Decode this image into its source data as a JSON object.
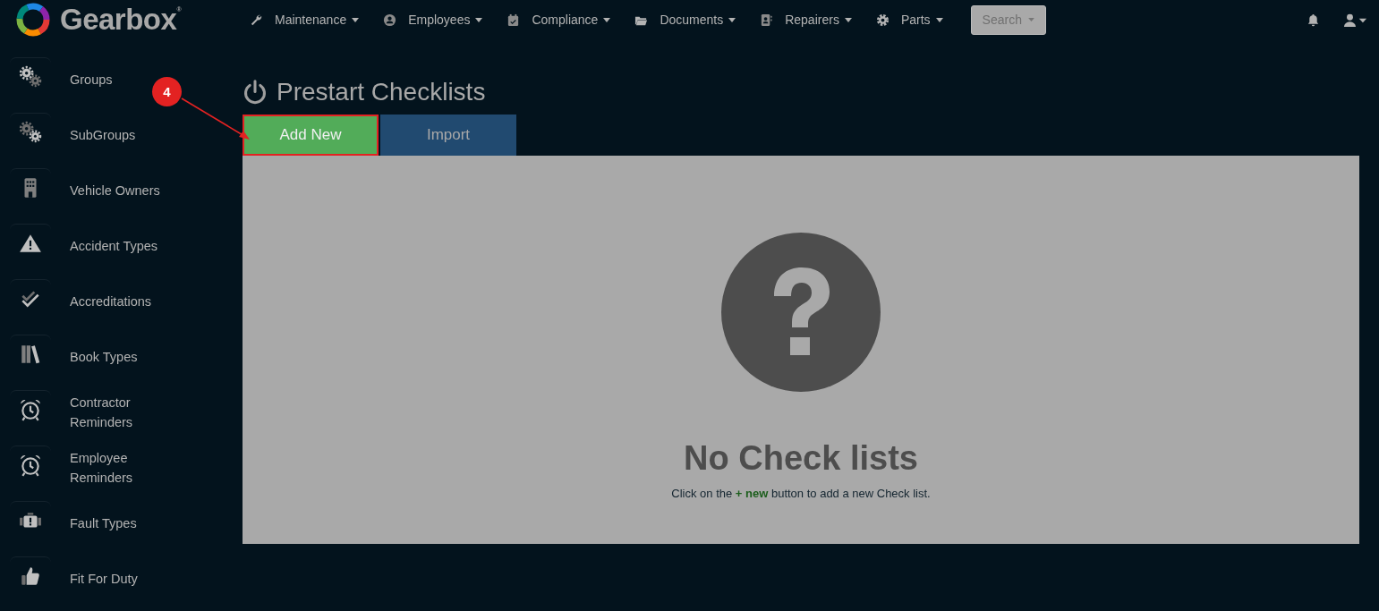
{
  "brand": {
    "name": "Gearbox$^{®}$"
  },
  "nav": [
    {
      "label": "Maintenance"
    },
    {
      "label": "Employees"
    },
    {
      "label": "Compliance"
    },
    {
      "label": "Documents"
    },
    {
      "label": "Repairers"
    },
    {
      "label": "Parts"
    }
  ],
  "search_button": {
    "label": "Search"
  },
  "sidebar": {
    "items": [
      {
        "label": "Groups"
      },
      {
        "label": "SubGroups"
      },
      {
        "label": "Vehicle Owners"
      },
      {
        "label": "Accident Types"
      },
      {
        "label": "Accreditations"
      },
      {
        "label": "Book Types"
      },
      {
        "label": "Contractor Reminders"
      },
      {
        "label": "Employee Reminders"
      },
      {
        "label": "Fault Types"
      },
      {
        "label": "Fit For Duty"
      }
    ]
  },
  "page": {
    "title": "Prestart Checklists",
    "actions": [
      {
        "label": "Add New",
        "kind": "primary",
        "highlighted": true
      },
      {
        "label": "Import",
        "kind": "secondary",
        "highlighted": false
      }
    ],
    "empty_state": {
      "heading": "No Check lists",
      "message": "Click on the **+ new** button to add a new Check list."
    }
  },
  "annotation": {
    "label": "4"
  }
}
